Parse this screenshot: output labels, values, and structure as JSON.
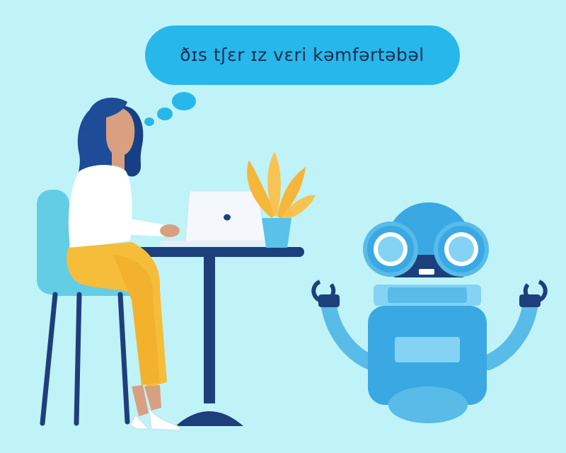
{
  "speech_bubble": {
    "text": "ðɪs tʃɛr ɪz vɛri kəmfərtəbəl"
  },
  "colors": {
    "background": "#bff3f8",
    "bubble": "#27b7ea",
    "navy": "#1d3f7c",
    "robot_blue": "#3aa9e3",
    "robot_light": "#84d3f4",
    "chair": "#63cde6",
    "pants": "#f6bd3b",
    "shirt": "#ffffff",
    "skin": "#d8a080",
    "hair": "#1e4c97",
    "plant": "#f5b63a"
  },
  "icons": [
    "woman-figure",
    "chair",
    "table",
    "laptop",
    "plant",
    "robot",
    "thought-bubble"
  ]
}
